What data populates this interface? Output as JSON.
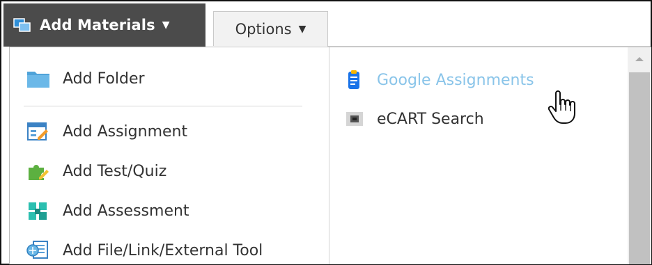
{
  "toolbar": {
    "add_materials_label": "Add Materials",
    "options_label": "Options",
    "caret": "▼"
  },
  "menu": {
    "left_items": [
      {
        "label": "Add Folder",
        "icon": "folder-icon"
      },
      {
        "label": "Add Assignment",
        "icon": "assignment-icon"
      },
      {
        "label": "Add Test/Quiz",
        "icon": "test-quiz-icon"
      },
      {
        "label": "Add Assessment",
        "icon": "assessment-icon"
      },
      {
        "label": "Add File/Link/External Tool",
        "icon": "file-link-icon"
      }
    ],
    "right_items": [
      {
        "label": "Google Assignments",
        "icon": "clipboard-icon",
        "state": "hovered"
      },
      {
        "label": "eCART Search",
        "icon": "ecart-icon"
      }
    ]
  },
  "colors": {
    "toolbar_dark": "#4b4b4b",
    "hover_link": "#89c4e9",
    "text": "#333333"
  }
}
